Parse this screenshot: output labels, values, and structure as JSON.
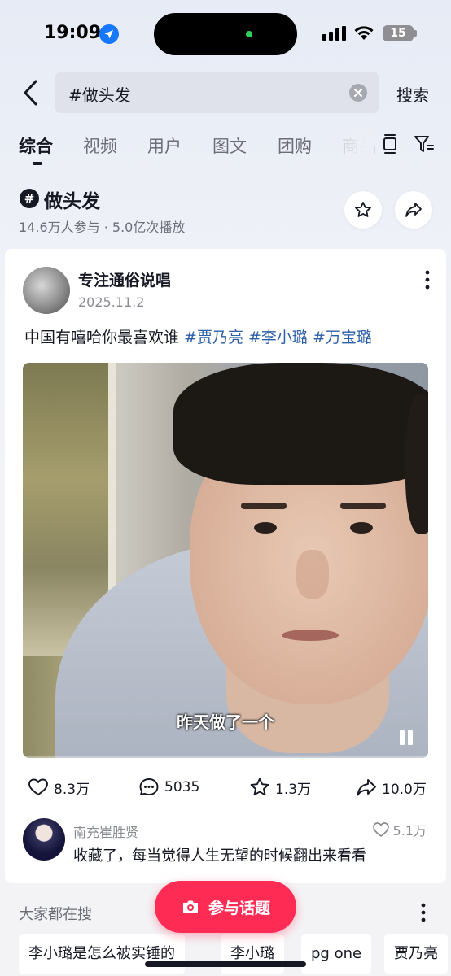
{
  "status_bar": {
    "time": "19:09",
    "battery": "15",
    "icons": [
      "location-arrow-icon",
      "signal-icon",
      "wifi-icon",
      "battery-icon"
    ]
  },
  "search": {
    "value": "#做头发",
    "button_label": "搜索"
  },
  "tabs": [
    {
      "label": "综合",
      "active": true
    },
    {
      "label": "视频"
    },
    {
      "label": "用户"
    },
    {
      "label": "图文"
    },
    {
      "label": "团购"
    },
    {
      "label": "商品"
    }
  ],
  "topic": {
    "icon": "#",
    "title": "做头发",
    "stats": "14.6万人参与 · 5.0亿次播放"
  },
  "post": {
    "author": "专注通俗说唱",
    "date": "2025.11.2",
    "text_prefix": "中国有嘻哈你最喜欢谁 ",
    "hashtags": [
      "#贾乃亮",
      "#李小璐",
      "#万宝璐"
    ],
    "video_subtitle": "昨天做了一个",
    "actions": {
      "likes": "8.3万",
      "comments": "5035",
      "favorites": "1.3万",
      "shares": "10.0万"
    },
    "top_comment": {
      "user": "南充崔胜贤",
      "likes": "5.1万",
      "text": "收藏了，每当觉得人生无望的时候翻出来看看"
    }
  },
  "trending": {
    "title": "大家都在搜",
    "items": [
      "李小璐是怎么被实锤的",
      "李小璐",
      "pg one",
      "贾乃亮"
    ]
  },
  "fab": {
    "label": "参与话题"
  },
  "colors": {
    "accent": "#fe2c55",
    "hashtag": "#2b5fa8",
    "location_blue": "#1677ff"
  }
}
